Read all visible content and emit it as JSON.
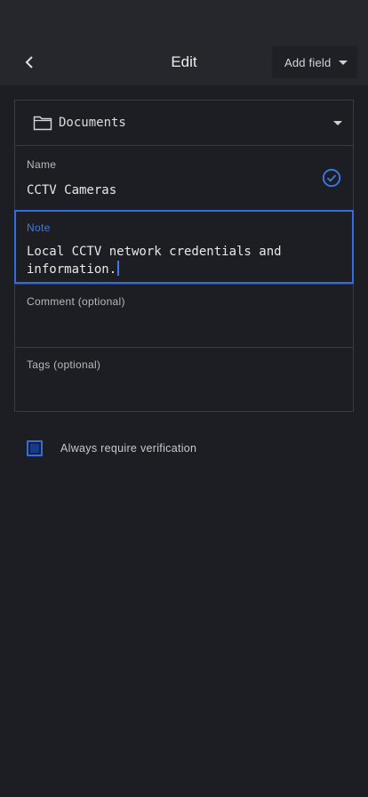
{
  "header": {
    "title": "Edit",
    "back_icon": "chevron-left-icon",
    "add_field_label": "Add field",
    "add_field_icon": "caret-down-icon"
  },
  "folder": {
    "label": "Documents",
    "icon": "folder-icon",
    "dropdown_icon": "caret-down-icon"
  },
  "fields": {
    "name": {
      "label": "Name",
      "value": "CCTV Cameras",
      "status_icon": "check-circle-icon"
    },
    "note": {
      "label": "Note",
      "value": "Local CCTV network credentials and\ninformation."
    },
    "comment": {
      "label": "Comment (optional)",
      "value": ""
    },
    "tags": {
      "label": "Tags (optional)",
      "value": ""
    }
  },
  "verification": {
    "label": "Always require verification",
    "checked": false
  },
  "colors": {
    "background": "#1d1e23",
    "header": "#26272c",
    "accent": "#2f6de1",
    "border": "#3a3b41"
  }
}
